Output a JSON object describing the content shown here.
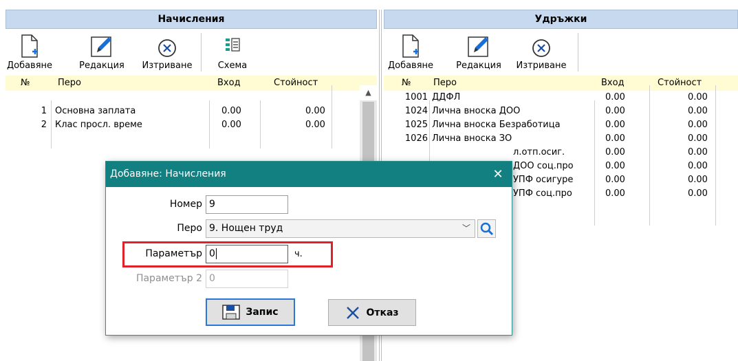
{
  "left_panel": {
    "title": "Начисления",
    "toolbar": {
      "add_label": "Добавяне",
      "edit_label": "Редакция",
      "delete_label": "Изтриване",
      "scheme_label": "Схема"
    },
    "columns": {
      "num": "№",
      "item": "Перо",
      "input": "Вход",
      "value": "Стойност"
    },
    "rows": [
      {
        "num": "1",
        "item": "Основна заплата",
        "input": "0.00",
        "value": "0.00"
      },
      {
        "num": "2",
        "item": "Клас просл. време",
        "input": "0.00",
        "value": "0.00"
      }
    ]
  },
  "right_panel": {
    "title": "Удръжки",
    "toolbar": {
      "add_label": "Добавяне",
      "edit_label": "Редакция",
      "delete_label": "Изтриване"
    },
    "columns": {
      "num": "№",
      "item": "Перо",
      "input": "Вход",
      "value": "Стойност"
    },
    "rows": [
      {
        "num": "1001",
        "item": "ДДФЛ",
        "input": "0.00",
        "value": "0.00"
      },
      {
        "num": "1024",
        "item": "Лична вноска ДОО",
        "input": "0.00",
        "value": "0.00"
      },
      {
        "num": "1025",
        "item": "Лична вноска Безработица",
        "input": "0.00",
        "value": "0.00"
      },
      {
        "num": "1026",
        "item": "Лична вноска ЗО",
        "input": "0.00",
        "value": "0.00"
      },
      {
        "num": "",
        "item": "л.отп.осиг.",
        "input": "0.00",
        "value": "0.00"
      },
      {
        "num": "",
        "item": "ДОО соц.про",
        "input": "0.00",
        "value": "0.00"
      },
      {
        "num": "",
        "item": "УПФ осигуре",
        "input": "0.00",
        "value": "0.00"
      },
      {
        "num": "",
        "item": "УПФ соц.про",
        "input": "0.00",
        "value": "0.00"
      }
    ]
  },
  "dialog": {
    "title": "Добавяне: Начисления",
    "number_label": "Номер",
    "number_value": "9",
    "item_label": "Перо",
    "item_value": "9. Нощен труд",
    "param_label": "Параметър",
    "param_value": "0",
    "param_unit": "ч.",
    "param2_label": "Параметър 2",
    "param2_value": "0",
    "save_label": "Запис",
    "cancel_label": "Отказ"
  },
  "colors": {
    "header_bg": "#c6d9ef",
    "grid_header_bg": "#fffbd3",
    "dialog_title_bg": "#127f80",
    "highlight": "#e0202a",
    "primary_border": "#2a78d4"
  }
}
